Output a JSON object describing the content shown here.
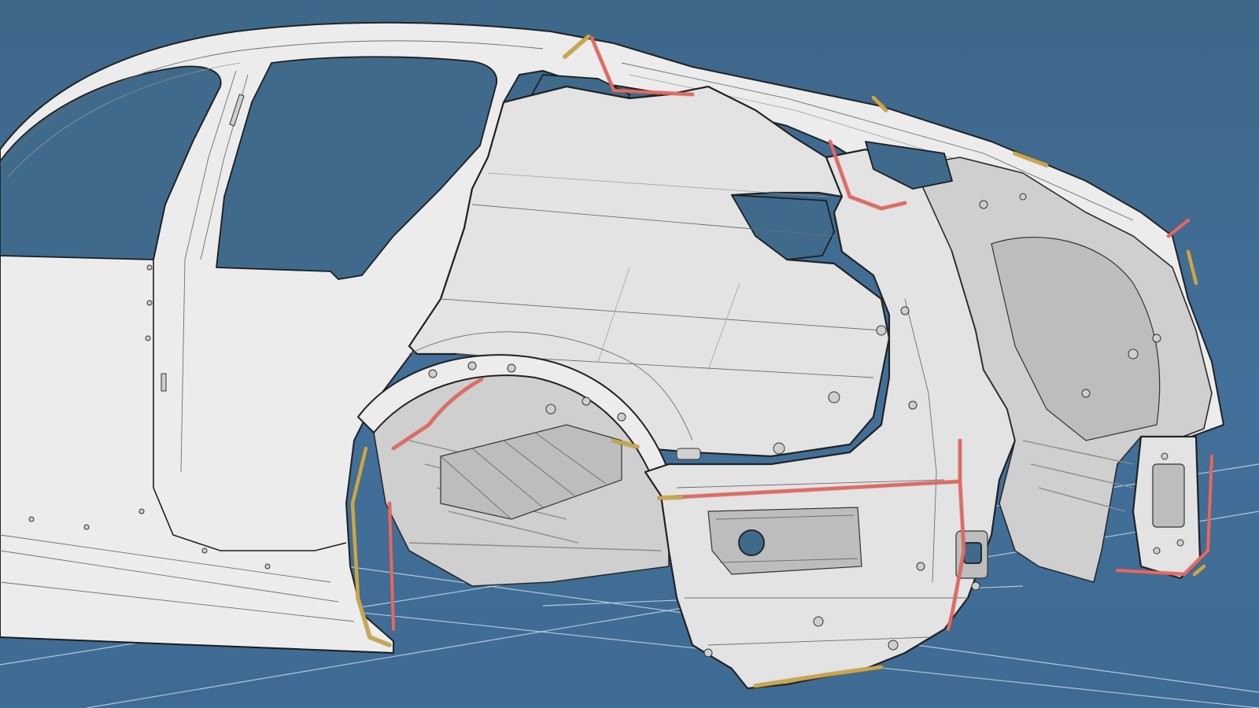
{
  "viewport": {
    "background": "#3f6a8c",
    "model": "vehicle-body-in-white-rear-quarter",
    "render_style": "shaded-with-edges",
    "panel_color": "#e3e3e3",
    "edge_color": "#222222"
  },
  "seam_sealer": {
    "primary_color": "#e06a63",
    "secondary_color": "#c9a64a"
  }
}
